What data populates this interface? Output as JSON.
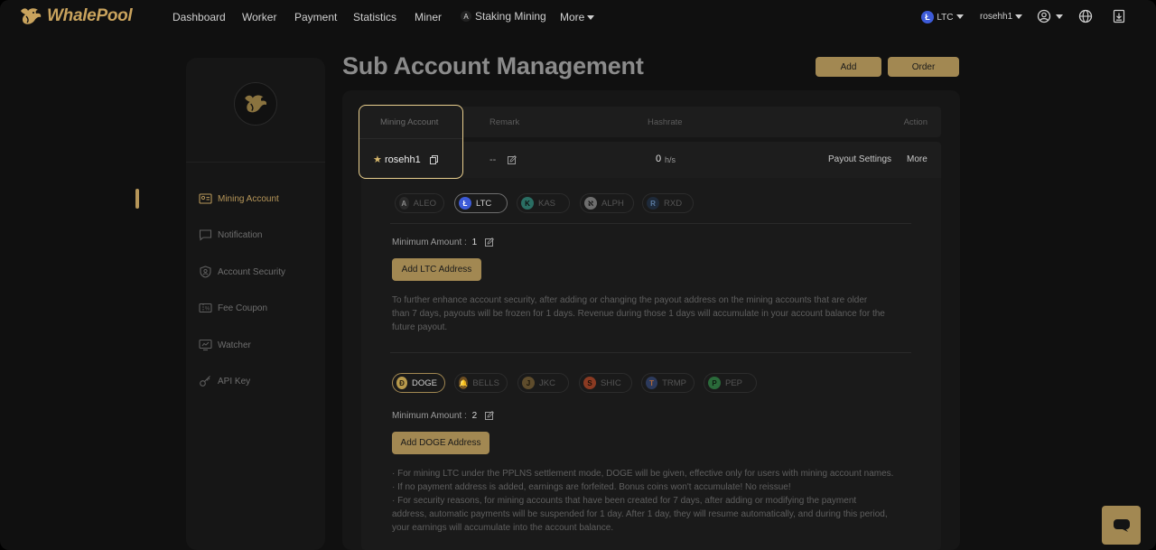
{
  "brand": {
    "name": "WhalePool"
  },
  "nav": {
    "items": [
      "Dashboard",
      "Worker",
      "Payment",
      "Statistics",
      "Miner"
    ],
    "staking": "Staking Mining",
    "more": "More",
    "coin": "LTC",
    "user": "rosehh1"
  },
  "sidebar": {
    "items": [
      {
        "label": "Mining Account",
        "icon": "account-card-icon"
      },
      {
        "label": "Notification",
        "icon": "message-icon"
      },
      {
        "label": "Account Security",
        "icon": "shield-user-icon"
      },
      {
        "label": "Fee Coupon",
        "icon": "coupon-icon"
      },
      {
        "label": "Watcher",
        "icon": "monitor-icon"
      },
      {
        "label": "API Key",
        "icon": "key-icon"
      }
    ]
  },
  "page": {
    "title": "Sub Account Management",
    "add_label": "Add",
    "order_label": "Order"
  },
  "table": {
    "headers": {
      "account": "Mining Account",
      "remark": "Remark",
      "hashrate": "Hashrate",
      "action": "Action"
    },
    "row": {
      "account": "rosehh1",
      "remark": "--",
      "hashrate_value": "0",
      "hashrate_unit": "h/s",
      "payout_settings": "Payout Settings",
      "more": "More"
    }
  },
  "section1": {
    "coins": [
      "ALEO",
      "LTC",
      "KAS",
      "ALPH",
      "RXD"
    ],
    "selected": "LTC",
    "min_label": "Minimum Amount :",
    "min_value": "1",
    "add_button": "Add LTC Address",
    "note_lines": [
      "To further enhance account security, after adding or changing the payout address on the mining accounts that are older",
      "than 7 days, payouts will be frozen for 1 days. Revenue during those 1 days will accumulate in your account balance for the",
      "future payout."
    ]
  },
  "section2": {
    "coins": [
      "DOGE",
      "BELLS",
      "JKC",
      "SHIC",
      "TRMP",
      "PEP"
    ],
    "selected": "DOGE",
    "min_label": "Minimum Amount :",
    "min_value": "2",
    "add_button": "Add DOGE Address",
    "note_lines": [
      "· For mining LTC under the PPLNS settlement mode, DOGE will be given, effective only for users with mining account names.",
      "· If no payment address is added, earnings are forfeited. Bonus coins won't accumulate! No reissue!",
      "· For security reasons, for mining accounts that have been created for 7 days, after adding or modifying the payment",
      "address, automatic payments will be suspended for 1 day. After 1 day, they will resume automatically, and during this period,",
      "your earnings will accumulate into the account balance."
    ]
  },
  "colors": {
    "accent": "#a28852",
    "highlight": "#e9cf8e",
    "ltc": "#3d5bd8"
  }
}
